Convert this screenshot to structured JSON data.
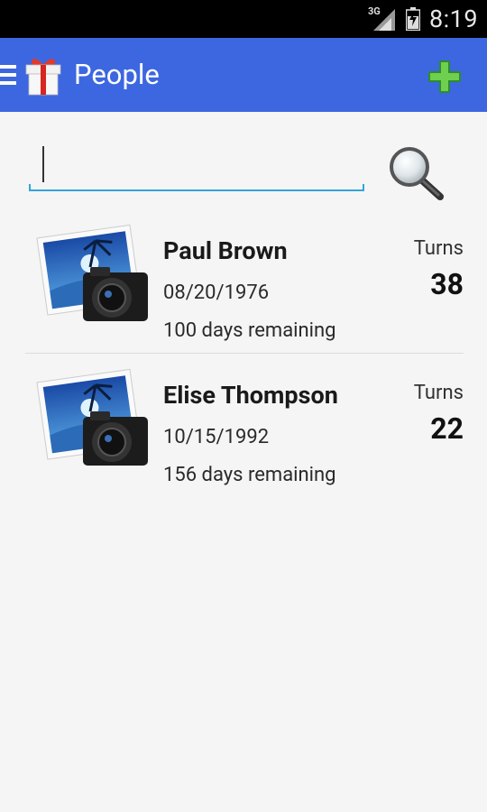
{
  "status_bar": {
    "network_type": "3G",
    "time": "8:19",
    "icons": [
      "signal-icon",
      "battery-icon"
    ]
  },
  "app_bar": {
    "title": "People",
    "icons": [
      "menu-icon",
      "gift-icon",
      "add-icon"
    ],
    "color": "#3d67e0"
  },
  "search": {
    "value": "",
    "placeholder": "",
    "icon": "search-icon"
  },
  "people": [
    {
      "name": "Paul Brown",
      "date": "08/20/1976",
      "remaining": "100 days remaining",
      "turns_label": "Turns",
      "turns": "38"
    },
    {
      "name": "Elise Thompson",
      "date": "10/15/1992",
      "remaining": "156 days remaining",
      "turns_label": "Turns",
      "turns": "22"
    }
  ]
}
